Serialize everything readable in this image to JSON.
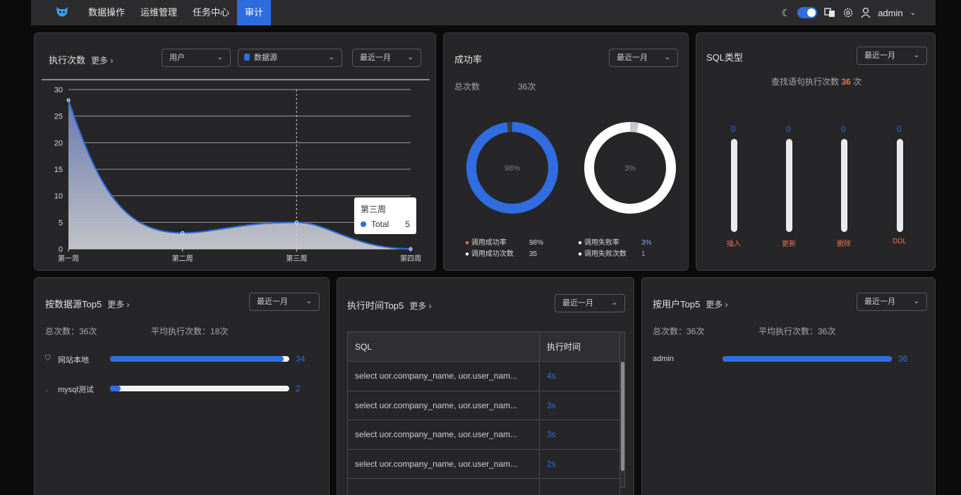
{
  "nav": {
    "items": [
      "数据操作",
      "运维管理",
      "任务中心",
      "审计"
    ],
    "active_index": 3,
    "user": "admin"
  },
  "exec_count": {
    "title": "执行次数",
    "more": "更多 ›",
    "filters": {
      "user": "用户",
      "datasource": "数据源",
      "range": "最近一月"
    },
    "tooltip": {
      "title": "第三周",
      "series": "Total",
      "value": "5"
    }
  },
  "chart_data": {
    "type": "area",
    "categories": [
      "第一周",
      "第二周",
      "第三周",
      "第四周"
    ],
    "series": [
      {
        "name": "Total",
        "values": [
          28,
          3,
          5,
          0
        ]
      }
    ],
    "yticks": [
      0,
      5,
      10,
      15,
      20,
      25,
      30
    ],
    "ylim": [
      0,
      30
    ],
    "grid": true
  },
  "success_rate": {
    "title": "成功率",
    "range": "最近一月",
    "total_label": "总次数",
    "total_value": "36次",
    "success_percent_label": "98%",
    "fail_percent_label": "3%",
    "success_fraction": 0.98,
    "fail_fraction": 0.03,
    "legend": {
      "success_rate_label": "调用成功率",
      "success_rate_value": "98%",
      "success_count_label": "调用成功次数",
      "success_count_value": "35",
      "fail_rate_label": "调用失败率",
      "fail_rate_value": "3%",
      "fail_count_label": "调用失败次数",
      "fail_count_value": "1"
    },
    "colors": {
      "success": "#2f6de0",
      "fail": "#ffffff",
      "accent": "#e8744a"
    }
  },
  "sql_type": {
    "title": "SQL类型",
    "range": "最近一月",
    "summary_prefix": "查找语句执行次数",
    "summary_value": "36",
    "summary_suffix": "次",
    "bars": [
      {
        "label": "插入",
        "value": "0"
      },
      {
        "label": "更新",
        "value": "0"
      },
      {
        "label": "删除",
        "value": "0"
      },
      {
        "label": "DDL",
        "value": "0"
      }
    ]
  },
  "ds_top5": {
    "title": "按数据源Top5",
    "more": "更多 ›",
    "range": "最近一月",
    "total": "总次数：36次",
    "avg": "平均执行次数：18次",
    "items": [
      {
        "name": "网站本地",
        "value": "34",
        "fraction": 0.97
      },
      {
        "name": "mysql测试",
        "value": "2",
        "fraction": 0.06
      }
    ]
  },
  "time_top5": {
    "title": "执行时间Top5",
    "more": "更多 ›",
    "range": "最近一月",
    "headers": [
      "SQL",
      "执行时间"
    ],
    "rows": [
      {
        "sql": "select uor.company_name, uor.user_nam...",
        "time": "4s"
      },
      {
        "sql": "select uor.company_name, uor.user_nam...",
        "time": "3s"
      },
      {
        "sql": "select uor.company_name, uor.user_nam...",
        "time": "3s"
      },
      {
        "sql": "select uor.company_name, uor.user_nam...",
        "time": "2s"
      }
    ]
  },
  "user_top5": {
    "title": "按用户Top5",
    "more": "更多 ›",
    "range": "最近一月",
    "total": "总次数：36次",
    "avg": "平均执行次数：36次",
    "items": [
      {
        "name": "admin",
        "value": "36",
        "fraction": 1.0
      }
    ]
  }
}
